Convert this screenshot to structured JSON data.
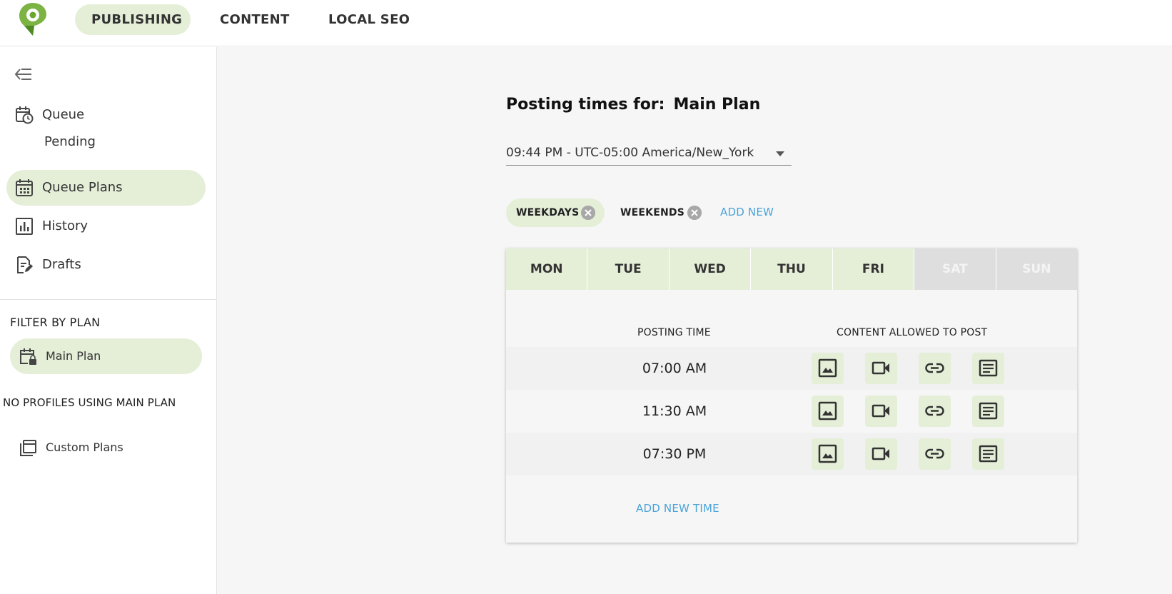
{
  "nav": {
    "tabs": [
      {
        "label": "PUBLISHING",
        "active": true
      },
      {
        "label": "CONTENT",
        "active": false
      },
      {
        "label": "LOCAL SEO",
        "active": false
      }
    ]
  },
  "sidebar": {
    "items": [
      {
        "label": "Queue",
        "icon": "calendar-clock-icon"
      },
      {
        "label": "Pending"
      },
      {
        "label": "Queue Plans",
        "icon": "calendar-grid-icon",
        "active": true
      },
      {
        "label": "History",
        "icon": "bar-chart-icon"
      },
      {
        "label": "Drafts",
        "icon": "edit-document-icon"
      }
    ],
    "filter_title": "FILTER BY PLAN",
    "plan": {
      "label": "Main Plan",
      "icon": "calendar-lock-icon"
    },
    "no_profiles": "NO PROFILES USING MAIN PLAN",
    "custom_plans": {
      "label": "Custom Plans",
      "icon": "stacked-calendars-icon"
    }
  },
  "main": {
    "title_prefix": "Posting times for:",
    "title_plan": "Main Plan",
    "timezone": "09:44 PM - UTC-05:00 America/New_York",
    "chips": [
      {
        "label": "WEEKDAYS",
        "active": true
      },
      {
        "label": "WEEKENDS",
        "active": false
      }
    ],
    "add_new": "ADD NEW",
    "days": [
      {
        "label": "MON",
        "enabled": true
      },
      {
        "label": "TUE",
        "enabled": true
      },
      {
        "label": "WED",
        "enabled": true
      },
      {
        "label": "THU",
        "enabled": true
      },
      {
        "label": "FRI",
        "enabled": true
      },
      {
        "label": "SAT",
        "enabled": false
      },
      {
        "label": "SUN",
        "enabled": false
      }
    ],
    "col_posting_time": "POSTING TIME",
    "col_content_allowed": "CONTENT ALLOWED TO POST",
    "times": [
      "07:00 AM",
      "11:30 AM",
      "07:30 PM"
    ],
    "content_types": [
      "image-icon",
      "video-icon",
      "link-icon",
      "text-icon"
    ],
    "add_new_time": "ADD NEW TIME"
  },
  "colors": {
    "accent_green": "#e5efd8",
    "brand_green": "#6aa72f",
    "link_blue": "#4aa3d9"
  }
}
